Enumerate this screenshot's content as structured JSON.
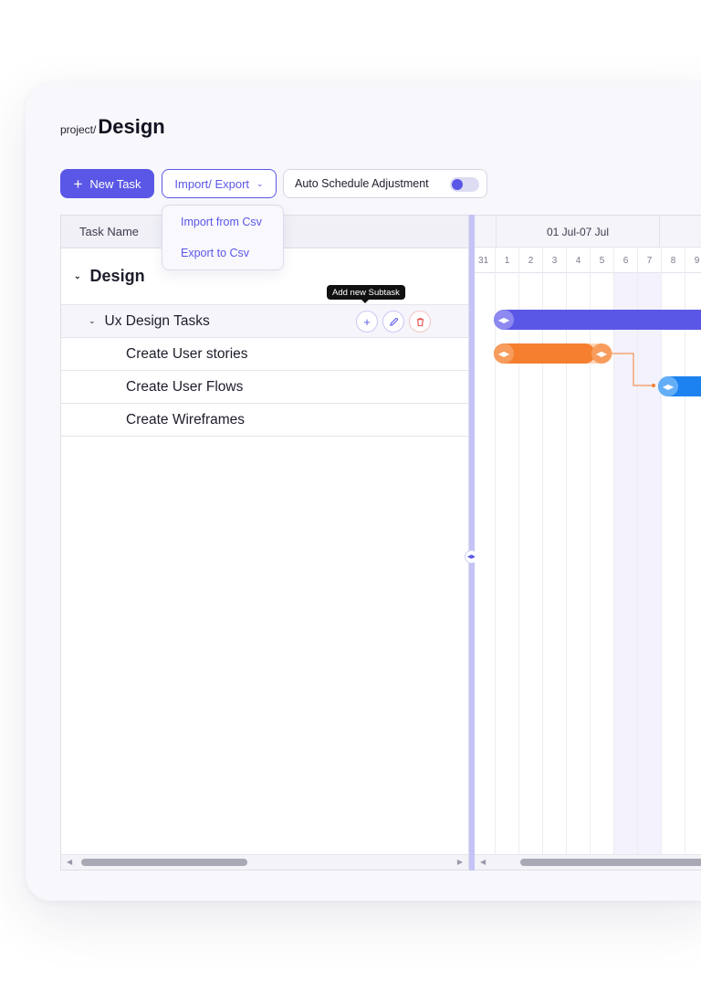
{
  "breadcrumb": {
    "prefix": "project/",
    "title": "Design"
  },
  "toolbar": {
    "new_task_label": "New Task",
    "import_export_label": "Import/ Export",
    "auto_schedule_label": "Auto Schedule Adjustment",
    "auto_schedule_enabled": true
  },
  "dropdown": {
    "items": [
      "Import from Csv",
      "Export to Csv"
    ]
  },
  "table": {
    "header": "Task Name",
    "project": "Design",
    "group": "Ux Design Tasks",
    "subtasks": [
      "Create User stories",
      "Create User Flows",
      "Create Wireframes"
    ]
  },
  "tooltip": {
    "text": "Add new Subtask"
  },
  "gantt": {
    "week_label": "01 Jul-07 Jul",
    "days": [
      "31",
      "1",
      "2",
      "3",
      "4",
      "5",
      "6",
      "7",
      "8",
      "9"
    ]
  },
  "colors": {
    "accent": "#5b57e6",
    "orange": "#f57f2e",
    "blue": "#1c82f0",
    "delete": "#e24a4a"
  }
}
